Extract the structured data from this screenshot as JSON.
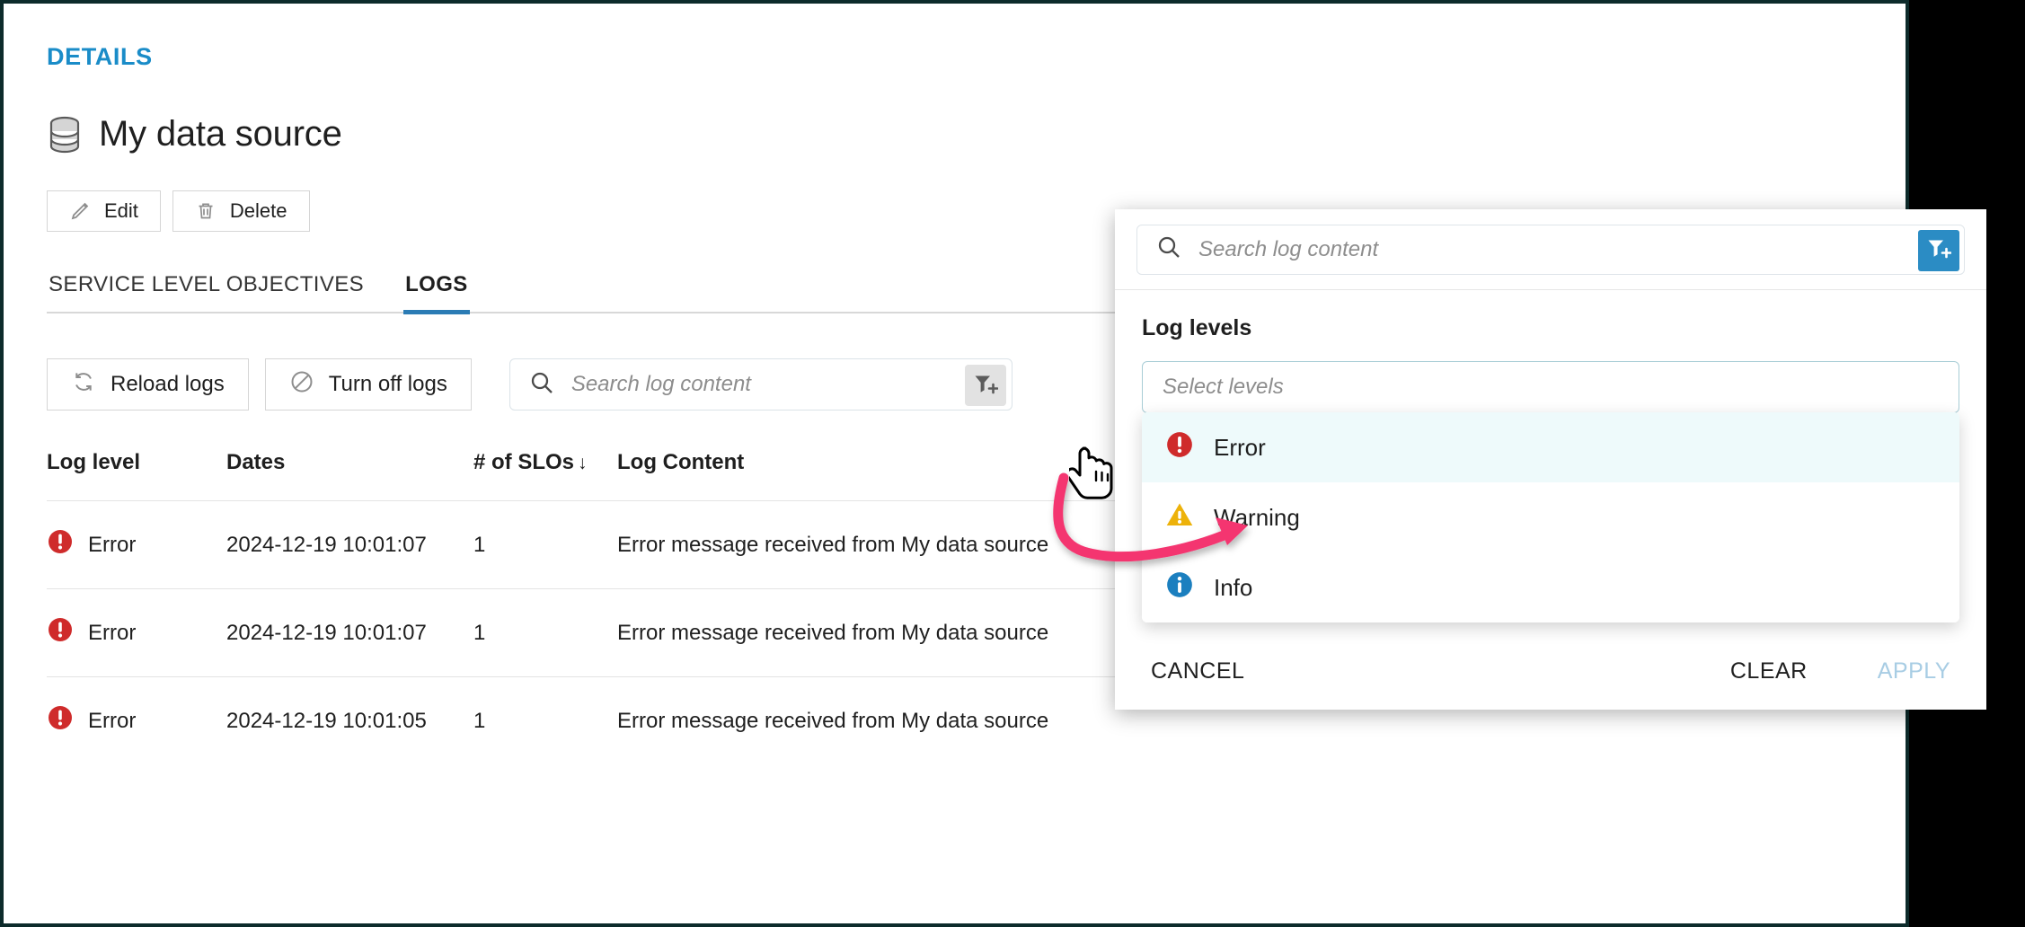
{
  "page": {
    "section_label": "DETAILS",
    "title": "My data source",
    "data_source_icon": "database-icon"
  },
  "actions": {
    "edit": "Edit",
    "delete": "Delete",
    "edit_icon": "pencil-icon",
    "delete_icon": "trash-icon"
  },
  "tabs": [
    {
      "label": "SERVICE LEVEL OBJECTIVES",
      "active": false
    },
    {
      "label": "LOGS",
      "active": true
    }
  ],
  "logs_toolbar": {
    "reload_label": "Reload logs",
    "reload_icon": "refresh-icon",
    "turn_off_label": "Turn off logs",
    "turn_off_icon": "block-icon",
    "search_placeholder": "Search log content",
    "search_value": "",
    "search_icon": "search-icon",
    "filter_icon": "filter-add-icon"
  },
  "table": {
    "columns": [
      "Log level",
      "Dates",
      "# of SLOs",
      "Log Content"
    ],
    "sort_column": "# of SLOs",
    "sort_direction_glyph": "↓",
    "rows": [
      {
        "level": "Error",
        "level_icon": "error-icon",
        "date": "2024-12-19 10:01:07",
        "slos": "1",
        "content": "Error message received from My data source"
      },
      {
        "level": "Error",
        "level_icon": "error-icon",
        "date": "2024-12-19 10:01:07",
        "slos": "1",
        "content": "Error message received from My data source"
      },
      {
        "level": "Error",
        "level_icon": "error-icon",
        "date": "2024-12-19 10:01:05",
        "slos": "1",
        "content": "Error message received from My data source"
      }
    ]
  },
  "filter_popup": {
    "search_placeholder": "Search log content",
    "search_value": "",
    "search_icon": "search-icon",
    "filter_icon": "filter-add-icon",
    "section_label": "Log levels",
    "select_placeholder": "Select levels",
    "select_value": "",
    "options": [
      {
        "label": "Error",
        "icon": "error-icon",
        "highlighted": true
      },
      {
        "label": "Warning",
        "icon": "warning-icon",
        "highlighted": false
      },
      {
        "label": "Info",
        "icon": "info-icon",
        "highlighted": false
      }
    ],
    "cancel_label": "CANCEL",
    "clear_label": "CLEAR",
    "apply_label": "APPLY",
    "apply_disabled": true
  },
  "annotation": {
    "arrow_color": "#f4346f",
    "cursor_icon": "pointing-hand-cursor"
  },
  "colors": {
    "accent_blue": "#2b7cb5",
    "link_blue": "#1a8cc8",
    "error_red": "#cf2b2b",
    "warning_yellow": "#edb20a",
    "info_blue": "#1b7fbf",
    "apply_disabled": "#a8cde4"
  }
}
